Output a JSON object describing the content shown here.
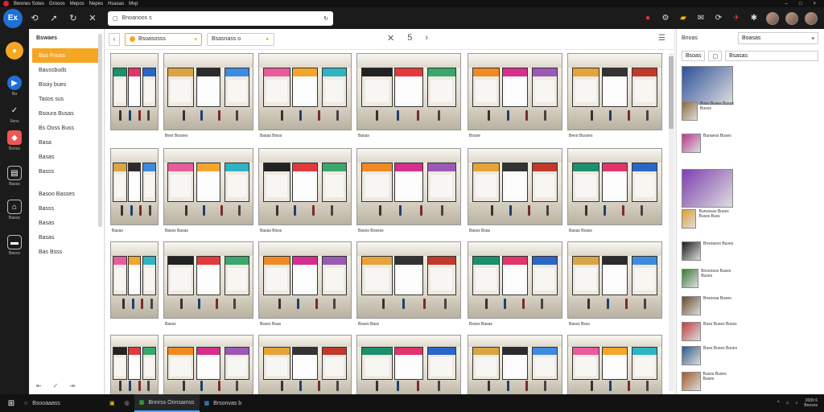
{
  "menubar": {
    "items": [
      "Bwsnes Sotes",
      "Grooos",
      "Mepos",
      "Nepes",
      "Hsasas",
      "Mvp"
    ],
    "controls": [
      "–",
      "□",
      "×"
    ]
  },
  "toolbar": {
    "logo_label": "Ex",
    "address_value": "Bnoanoos s",
    "icons": [
      "back-icon",
      "reload-icon",
      "home-icon",
      "close-icon"
    ]
  },
  "rail": {
    "items": [
      {
        "label": "",
        "color": "#f5a623",
        "icon": "●"
      },
      {
        "label": "Ba",
        "color": "#1f6fd6",
        "icon": "▶"
      },
      {
        "label": "Sens",
        "color": "#1b1b1b",
        "icon": "✓"
      },
      {
        "label": "Bsosa",
        "color": "#e55",
        "icon": "◆"
      },
      {
        "label": "Basss",
        "color": "#1b1b1b",
        "icon": "▤"
      },
      {
        "label": "Baoss",
        "color": "#1b1b1b",
        "icon": "⌂"
      },
      {
        "label": "Baoss",
        "color": "#1b1b1b",
        "icon": "▬"
      }
    ]
  },
  "sidebar": {
    "title": "Bswaes",
    "items": [
      {
        "label": "Bus Fnuss",
        "active": true
      },
      {
        "label": "Baussbuds",
        "active": false
      },
      {
        "label": "Bsoiy bues",
        "active": false
      },
      {
        "label": "Tasos sus",
        "active": false
      },
      {
        "label": "Bsoura Busas",
        "active": false
      },
      {
        "label": "Bs Ooss Buss",
        "active": false
      },
      {
        "label": "Basa",
        "active": false
      },
      {
        "label": "Basas",
        "active": false
      },
      {
        "label": "Basss",
        "active": false
      },
      {
        "label": "Basoo Basses",
        "active": false,
        "gap": true
      },
      {
        "label": "Basss",
        "active": false
      },
      {
        "label": "Basas",
        "active": false
      },
      {
        "label": "Basas",
        "active": false
      },
      {
        "label": "Bas Bsss",
        "active": false
      }
    ],
    "footer": [
      "⇤",
      "✓",
      "⇥"
    ]
  },
  "filters": {
    "chip1": "Bsoasosss",
    "chip2": "Bsasnass o",
    "pager_prev": "‹",
    "pager_page": "5",
    "pager_next": "›"
  },
  "grid": {
    "captions": [
      "",
      "Beor Bosses",
      "Basas Bisss",
      "Basas",
      "Bsose",
      "Beno Busses",
      "Basas",
      "Basss Basas",
      "Basas Bisss",
      "Basos Bosess",
      "Basss Bsas",
      "Basas Bsass",
      "",
      "Basss",
      "Bsses Bsas",
      "Bsses Bass",
      "Bsses Basas",
      "Basss Bsss",
      "",
      "",
      "",
      "",
      "",
      ""
    ]
  },
  "rpanel": {
    "head": "Bnoas",
    "select_value": "Boasas",
    "tab1": "Bsoas",
    "field_value": "Bsasas",
    "items": [
      {
        "label": ""
      },
      {
        "label": "Buso Buses Busos Busos"
      },
      {
        "label": "Bunaess Buses"
      },
      {
        "label": ""
      },
      {
        "label": "Bunsseas Buses Busss Buss"
      },
      {
        "label": "Bnsoasos Buses"
      },
      {
        "label": "Bnsoosos Buses Buses"
      },
      {
        "label": "Bnsoosa Buses"
      },
      {
        "label": "Buso Buses Busss"
      },
      {
        "label": "Buso Buses Buses"
      },
      {
        "label": "Busos Buses Buses"
      }
    ]
  },
  "taskbar": {
    "search_label": "Bsooaaass",
    "apps": [
      {
        "label": "",
        "icon": "▣"
      },
      {
        "label": "",
        "icon": "◎"
      },
      {
        "label": "Bnnrss Onnsamss",
        "icon": "▦",
        "active": true
      },
      {
        "label": "Brsonvas b",
        "icon": "▦",
        "active": false
      }
    ],
    "tray": [
      "^",
      "⌂",
      "♪"
    ],
    "time": "2009 6",
    "date": "Bnnsns"
  }
}
